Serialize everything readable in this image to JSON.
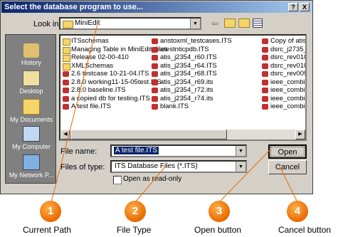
{
  "dialog": {
    "title": "Select the database program to use...",
    "help_btn": "?",
    "close_btn": "X",
    "look_in_label": "Look in:",
    "look_in_value": "MiniEdit",
    "file_name_label": "File name:",
    "file_name_value": "A test file.ITS",
    "file_type_label": "Files of type:",
    "file_type_value": "ITS Database Files (*.ITS)",
    "readonly_label": "Open as read-only",
    "open_label": "Open",
    "cancel_label": "Cancel"
  },
  "places": [
    "History",
    "Desktop",
    "My Documents",
    "My Computer",
    "My Network P..."
  ],
  "files": {
    "col1": [
      "ITSschemas",
      "Managing Table in MiniEdit_files",
      "Release 02-00-410",
      "XMLSchemas",
      "2.6 testcase 10-21-04.ITS",
      "2.8.0 working11-15-05test.ITS",
      "2.8.0 baseline.ITS",
      "a copied db for testing.ITS",
      "A test file.ITS"
    ],
    "col2": [
      "anstoxml_testcases.ITS",
      "atestnticpdb.ITS",
      "atis_j2354_r60.ITS",
      "atis_j2354_r64.ITS",
      "atis_j2354_r68.ITS",
      "atis_j2354_r69.its",
      "atis_j2354_r72.its",
      "atis_j2354_r74.its",
      "blank.ITS"
    ],
    "col3": [
      "Copy of atis_",
      "dsrc_j2735_r",
      "dsrc_rev010.",
      "dsrc_rev010_",
      "dsrc_rev009.I",
      "ieee_combine",
      "ieee_combine",
      "ieee_combine",
      "ieee_combine"
    ]
  },
  "callouts": [
    {
      "num": "1",
      "caption": "Current Path"
    },
    {
      "num": "2",
      "caption": "File Type"
    },
    {
      "num": "3",
      "caption": "Open button"
    },
    {
      "num": "4",
      "caption": "Cancel button"
    }
  ]
}
